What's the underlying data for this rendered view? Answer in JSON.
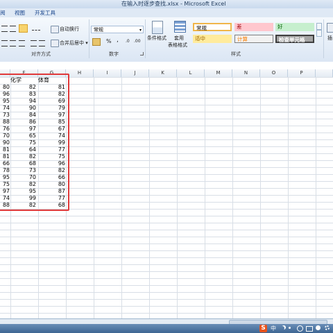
{
  "window": {
    "title": "在输入时逐步查找.xlsx - Microsoft Excel"
  },
  "tabs": [
    "阅",
    "视图",
    "开发工具"
  ],
  "ribbon": {
    "wrap_text": "自动换行",
    "merge_center": "合并后居中",
    "merge_center_arrow": "▾",
    "number_format": "常规",
    "percent": "%",
    "comma": ",",
    "dec_inc": ".0",
    "dec_dec": ".00",
    "conditional_format": "条件格式",
    "table_format_1": "套用",
    "table_format_2": "表格格式",
    "groups": {
      "alignment": "对齐方式",
      "number": "数字",
      "styles": "样式"
    },
    "styles": {
      "normal": "常规",
      "bad": "差",
      "good": "好",
      "neutral": "适中",
      "calculation": "计算",
      "check_cell": "检查单元格"
    },
    "insert_partial": "插"
  },
  "columns": [
    "F",
    "G",
    "H",
    "I",
    "J",
    "K",
    "L",
    "M",
    "N",
    "O",
    "P"
  ],
  "headers": {
    "chemistry": "化学",
    "pe": "体育"
  },
  "rows": [
    [
      "80",
      "82",
      "81"
    ],
    [
      "96",
      "83",
      "82"
    ],
    [
      "95",
      "94",
      "69"
    ],
    [
      "74",
      "90",
      "79"
    ],
    [
      "73",
      "84",
      "97"
    ],
    [
      "88",
      "86",
      "85"
    ],
    [
      "76",
      "97",
      "67"
    ],
    [
      "70",
      "65",
      "74"
    ],
    [
      "90",
      "75",
      "99"
    ],
    [
      "81",
      "64",
      "77"
    ],
    [
      "81",
      "82",
      "75"
    ],
    [
      "66",
      "68",
      "96"
    ],
    [
      "78",
      "73",
      "82"
    ],
    [
      "95",
      "70",
      "66"
    ],
    [
      "75",
      "82",
      "80"
    ],
    [
      "97",
      "95",
      "87"
    ],
    [
      "74",
      "99",
      "77"
    ],
    [
      "88",
      "82",
      "68"
    ]
  ],
  "taskbar": {
    "ime": "中"
  },
  "colors": {
    "highlight": "#e0393a",
    "bad_bg": "#ffc7ce",
    "good_bg": "#c6efce",
    "neutral_bg": "#ffeb9c"
  }
}
